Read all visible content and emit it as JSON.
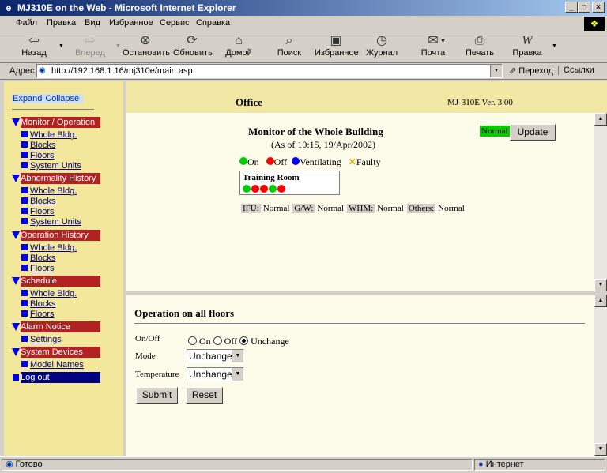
{
  "window": {
    "title": "MJ310E on the Web - Microsoft Internet Explorer"
  },
  "menu": [
    "Файл",
    "Правка",
    "Вид",
    "Избранное",
    "Сервис",
    "Справка"
  ],
  "toolbar": {
    "back": "Назад",
    "forward": "Вперед",
    "stop": "Остановить",
    "refresh": "Обновить",
    "home": "Домой",
    "search": "Поиск",
    "favorites": "Избранное",
    "history": "Журнал",
    "mail": "Почта",
    "print": "Печать",
    "edit": "Правка"
  },
  "address": {
    "label": "Адрес",
    "url": "http://192.168.1.16/mj310e/main.asp",
    "go": "Переход",
    "links": "Ссылки"
  },
  "nav": {
    "expand": "Expand",
    "collapse": "Collapse",
    "sections": [
      {
        "title": "Monitor / Operation",
        "items": [
          "Whole Bldg.",
          "Blocks",
          "Floors",
          "System Units"
        ]
      },
      {
        "title": "Abnormality History",
        "items": [
          "Whole Bldg.",
          "Blocks",
          "Floors",
          "System Units"
        ]
      },
      {
        "title": "Operation History",
        "items": [
          "Whole Bldg.",
          "Blocks",
          "Floors"
        ]
      },
      {
        "title": "Schedule",
        "items": [
          "Whole Bldg.",
          "Blocks",
          "Floors"
        ]
      },
      {
        "title": "Alarm Notice",
        "items": [
          "Settings"
        ]
      },
      {
        "title": "System Devices",
        "items": [
          "Model Names"
        ]
      },
      {
        "title": "Log out",
        "items": []
      }
    ]
  },
  "header": {
    "location": "Office",
    "version": "MJ-310E Ver. 3.00"
  },
  "monitor": {
    "title": "Monitor of the Whole Building",
    "as_of": "(As of 10:15, 19/Apr/2002)",
    "status": "Normal",
    "update": "Update",
    "legend": {
      "on": "On",
      "off": "Off",
      "ventilating": "Ventilating",
      "faulty": "Faulty"
    },
    "room": "Training Room",
    "units": [
      "on",
      "off",
      "off",
      "on",
      "off"
    ],
    "stats": [
      {
        "key": "IFU:",
        "value": "Normal"
      },
      {
        "key": "G/W:",
        "value": "Normal"
      },
      {
        "key": "WHM:",
        "value": "Normal"
      },
      {
        "key": "Others:",
        "value": "Normal"
      }
    ]
  },
  "operation": {
    "title": "Operation on all floors",
    "onoff_label": "On/Off",
    "radio_on": "On",
    "radio_off": "Off",
    "radio_unchange": "Unchange",
    "mode_label": "Mode",
    "mode_value": "Unchange",
    "temp_label": "Temperature",
    "temp_value": "Unchange",
    "submit": "Submit",
    "reset": "Reset"
  },
  "status": {
    "left": "Готово",
    "zone": "Интернет"
  },
  "colors": {
    "on": "#00cc00",
    "off": "#ff0000",
    "ventilating": "#0000ff",
    "faulty": "#e0b400"
  }
}
